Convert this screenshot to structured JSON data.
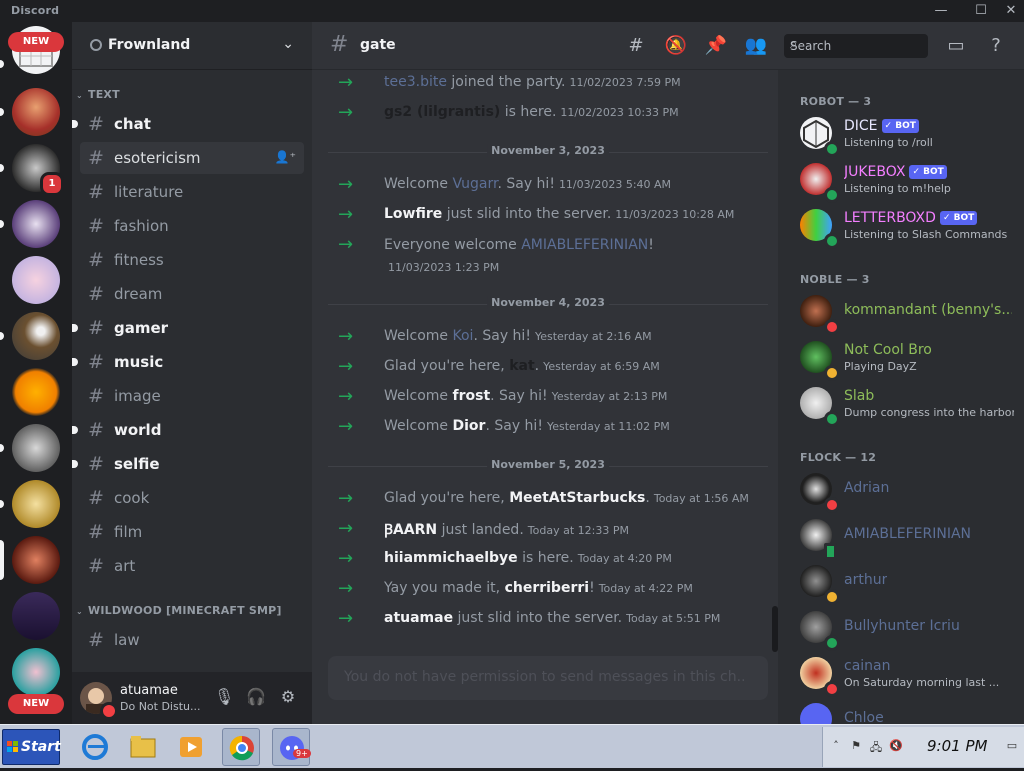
{
  "window": {
    "title": "Discord",
    "minimize": "—",
    "maximize": "☐",
    "close": "✕"
  },
  "rail": {
    "new_badge_top": "NEW",
    "new_badge_bottom": "NEW",
    "mention_count": "1"
  },
  "server": {
    "name": "Frownland"
  },
  "categories": {
    "text": "TEXT",
    "wildwood": "WILDWOOD [MINECRAFT SMP]"
  },
  "channels": [
    {
      "name": "chat",
      "unread": true
    },
    {
      "name": "esotericism",
      "unread": false,
      "active": true
    },
    {
      "name": "literature",
      "unread": false
    },
    {
      "name": "fashion",
      "unread": false
    },
    {
      "name": "fitness",
      "unread": false
    },
    {
      "name": "dream",
      "unread": false
    },
    {
      "name": "gamer",
      "unread": true
    },
    {
      "name": "music",
      "unread": true
    },
    {
      "name": "image",
      "unread": false
    },
    {
      "name": "world",
      "unread": true
    },
    {
      "name": "selfie",
      "unread": true
    },
    {
      "name": "cook",
      "unread": false
    },
    {
      "name": "film",
      "unread": false
    },
    {
      "name": "art",
      "unread": false
    }
  ],
  "wildwood_channels": [
    {
      "name": "law"
    }
  ],
  "user": {
    "name": "atuamae",
    "status": "Do Not Distu..."
  },
  "header": {
    "channel": "gate",
    "search_placeholder": "Search"
  },
  "messages": {
    "m1": {
      "user": "tee3.bite",
      "text": " joined the party.",
      "ts": "11/02/2023 7:59 PM"
    },
    "m2": {
      "user": "gs2 (lilgrantis)",
      "text": " is here.",
      "ts": "11/02/2023 10:33 PM"
    },
    "sep1": "November 3, 2023",
    "m3": {
      "pre": "Welcome ",
      "user": "Vugarr",
      "text": ". Say hi!",
      "ts": "11/03/2023 5:40 AM"
    },
    "m4": {
      "user": "Lowfire",
      "text": " just slid into the server.",
      "ts": "11/03/2023 10:28 AM"
    },
    "m5": {
      "pre": "Everyone welcome ",
      "user": "AMIABLEFERINIAN",
      "text": "!",
      "ts": "11/03/2023 1:23 PM"
    },
    "sep2": "November 4, 2023",
    "m6": {
      "pre": "Welcome ",
      "user": "Koi",
      "text": ". Say hi!",
      "ts": "Yesterday at 2:16 AM"
    },
    "m7": {
      "pre": "Glad you're here, ",
      "user": "kat",
      "text": ".",
      "ts": "Yesterday at 6:59 AM"
    },
    "m8": {
      "pre": "Welcome ",
      "user": "frost",
      "text": ". Say hi!",
      "ts": "Yesterday at 2:13 PM"
    },
    "m9": {
      "pre": "Welcome ",
      "user": "Dior",
      "text": ". Say hi!",
      "ts": "Yesterday at 11:02 PM"
    },
    "sep3": "November 5, 2023",
    "m10": {
      "pre": "Glad you're here, ",
      "user": "MeetAtStarbucks",
      "text": ".",
      "ts": "Today at 1:56 AM"
    },
    "m11": {
      "user": "ꞴAARN",
      "text": " just landed.",
      "ts": "Today at 12:33 PM"
    },
    "m12": {
      "user": "hiiammichaelbye",
      "text": " is here.",
      "ts": "Today at 4:20 PM"
    },
    "m13": {
      "pre": "Yay you made it, ",
      "user": "cherriberri",
      "text": "!",
      "ts": "Today at 4:22 PM"
    },
    "m14": {
      "user": "atuamae",
      "text": " just slid into the server.",
      "ts": "Today at 5:51 PM"
    }
  },
  "composer": {
    "placeholder": "You do not have permission to send messages in this ch..."
  },
  "members": {
    "robot_header": "ROBOT — 3",
    "noble_header": "NOBLE — 3",
    "flock_header": "FLOCK — 12",
    "bot_label": "✓ BOT",
    "robot": [
      {
        "name": "DICE",
        "activity": "Listening to /roll",
        "color": "#e8e8ff"
      },
      {
        "name": "JUKEBOX",
        "activity": "Listening to m!help",
        "color": "#f47fff"
      },
      {
        "name": "LETTERBOXD",
        "activity": "Listening to Slash Commands",
        "color": "#f47fff"
      }
    ],
    "noble": [
      {
        "name": "kommandant (benny's...",
        "activity": "",
        "color": "#8ebd5a"
      },
      {
        "name": "Not Cool Bro",
        "activity": "Playing DayZ",
        "color": "#8ebd5a"
      },
      {
        "name": "Slab",
        "activity": "Dump congress into the harbor",
        "color": "#8ebd5a"
      }
    ],
    "flock": [
      {
        "name": "Adrian",
        "activity": "",
        "color": "#5c6f96"
      },
      {
        "name": "AMIABLEFERINIAN",
        "activity": "",
        "color": "#5c6f96"
      },
      {
        "name": "arthur",
        "activity": "",
        "color": "#5c6f96"
      },
      {
        "name": "Bullyhunter Icriu",
        "activity": "",
        "color": "#5c6f96"
      },
      {
        "name": "cainan",
        "activity": "On Saturday morning last ...",
        "color": "#5c6f96"
      },
      {
        "name": "Chloe",
        "activity": "",
        "color": "#5c6f96"
      }
    ]
  },
  "taskbar": {
    "start": "Start",
    "clock": "9:01 PM",
    "discord_badge": "9+"
  }
}
